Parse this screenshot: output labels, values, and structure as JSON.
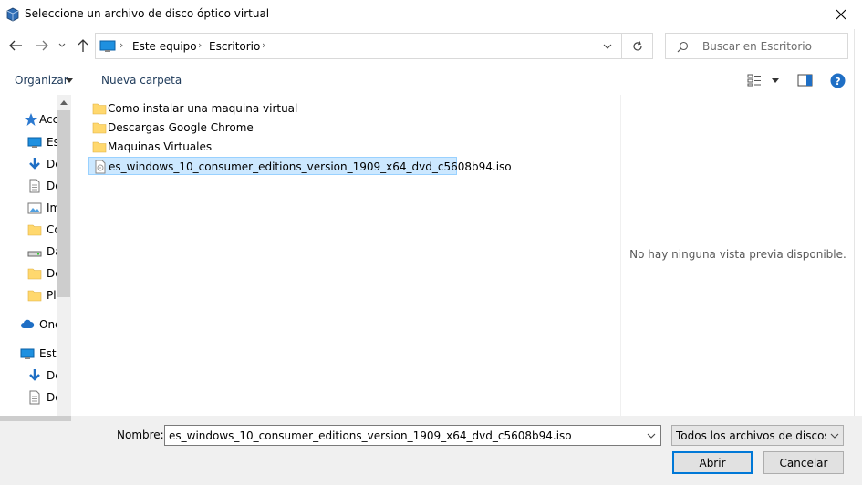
{
  "window": {
    "title": "Seleccione un archivo de disco óptico virtual"
  },
  "address": {
    "crumbs": [
      "Este equipo",
      "Escritorio"
    ]
  },
  "search": {
    "placeholder": "Buscar en Escritorio"
  },
  "toolbar": {
    "organize": "Organizar",
    "new_folder": "Nueva carpeta"
  },
  "nav": {
    "items": [
      {
        "label": "Acceso rápido",
        "icon": "star-icon"
      },
      {
        "label": "Escritorio",
        "icon": "desktop-icon"
      },
      {
        "label": "Descargas",
        "icon": "download-icon"
      },
      {
        "label": "Documentos",
        "icon": "document-icon"
      },
      {
        "label": "Imágenes",
        "icon": "image-icon"
      },
      {
        "label": "Como instalar",
        "icon": "folder-icon"
      },
      {
        "label": "Datos",
        "icon": "drive-icon"
      },
      {
        "label": "Descargas",
        "icon": "folder-icon"
      },
      {
        "label": "Plantillas",
        "icon": "folder-icon"
      },
      {
        "label": "OneDrive",
        "icon": "cloud-icon"
      },
      {
        "label": "Este equipo",
        "icon": "computer-icon"
      },
      {
        "label": "Descargas",
        "icon": "download-icon"
      },
      {
        "label": "Documentos",
        "icon": "document-icon"
      }
    ]
  },
  "files": [
    {
      "name": "Como instalar una maquina virtual",
      "type": "folder"
    },
    {
      "name": "Descargas Google Chrome",
      "type": "folder"
    },
    {
      "name": "Maquinas Virtuales",
      "type": "folder"
    },
    {
      "name": "es_windows_10_consumer_editions_version_1909_x64_dvd_c5608b94.iso",
      "type": "iso",
      "selected": true
    }
  ],
  "preview": {
    "message": "No hay ninguna vista previa disponible."
  },
  "footer": {
    "name_label": "Nombre:",
    "name_value": "es_windows_10_consumer_editions_version_1909_x64_dvd_c5608b94.iso",
    "filter_value": "Todos los archivos de discos óp",
    "open_label": "Abrir",
    "cancel_label": "Cancelar"
  },
  "colors": {
    "accent": "#0078d7",
    "selection": "#cce8ff",
    "folder": "#ffd86e"
  }
}
